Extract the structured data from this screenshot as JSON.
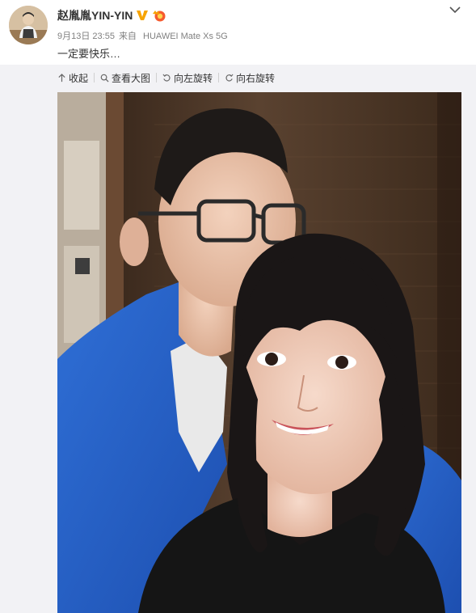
{
  "post": {
    "username": "赵胤胤YIN-YIN",
    "date": "9月13日 23:55",
    "source_prefix": "来自",
    "source": "HUAWEI Mate Xs 5G",
    "text": "一定要快乐…"
  },
  "toolbar": {
    "collapse_label": "收起",
    "view_large_label": "查看大图",
    "rotate_left_label": "向左旋转",
    "rotate_right_label": "向右旋转"
  },
  "icons": {
    "verified": "verified-v-icon",
    "member": "member-crown-icon",
    "menu": "chevron-down-icon",
    "collapse": "arrow-up-icon",
    "zoom": "magnifier-icon",
    "rotate_left": "rotate-left-icon",
    "rotate_right": "rotate-right-icon"
  },
  "colors": {
    "text_primary": "#333333",
    "text_meta": "#808080",
    "panel_bg": "#f2f2f5",
    "verified_orange": "#f7a400",
    "member_red": "#f55a2e"
  }
}
